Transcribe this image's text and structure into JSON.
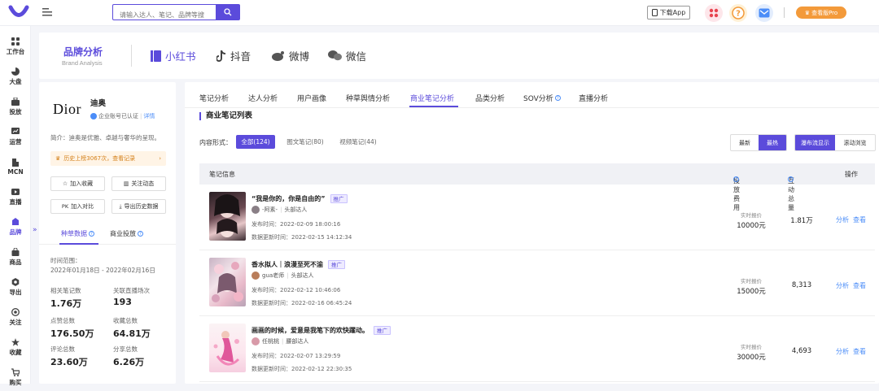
{
  "topbar": {
    "search_placeholder": "请输入达人、笔记、品牌等搜",
    "download_label": "下载App",
    "pro_label": "查看版Pro",
    "accent": "#5b4bdb"
  },
  "sidebar": {
    "items": [
      {
        "label": "工作台",
        "icon": "grid-icon"
      },
      {
        "label": "大盘",
        "icon": "pie-chart-icon"
      },
      {
        "label": "投放",
        "icon": "briefcase-icon"
      },
      {
        "label": "运营",
        "icon": "chart-icon"
      },
      {
        "label": "MCN",
        "icon": "building-icon"
      },
      {
        "label": "直播",
        "icon": "video-icon"
      },
      {
        "label": "品牌",
        "icon": "brand-icon"
      },
      {
        "label": "商品",
        "icon": "bag-icon"
      },
      {
        "label": "导出",
        "icon": "export-icon"
      },
      {
        "label": "关注",
        "icon": "eye-icon"
      },
      {
        "label": "收藏",
        "icon": "star-icon"
      },
      {
        "label": "购买",
        "icon": "cart-icon"
      }
    ],
    "collapse": "»"
  },
  "brand_header": {
    "title": "品牌分析",
    "subtitle": "Brand Analysis",
    "platforms": [
      {
        "label": "小红书"
      },
      {
        "label": "抖音"
      },
      {
        "label": "微博"
      },
      {
        "label": "微信"
      }
    ]
  },
  "brand": {
    "logo_text": "Dior",
    "name": "迪奥",
    "verified": "企业账号已认证",
    "verified_link": "详情",
    "intro": "简介：迪奥是优雅、卓越与奢华的呈现。",
    "history": "历史上榜3067次，查看记录",
    "buttons": {
      "collect": "加入收藏",
      "follow": "关注动态",
      "compare": "加入对比",
      "export_history": "导出历史数据"
    },
    "tabs": [
      "种草数据",
      "商业投放"
    ],
    "range_label": "时间范围：",
    "range_value": "2022年01月18日 - 2022年02月16日",
    "stats": [
      {
        "label": "相关笔记数",
        "value": "1.76万"
      },
      {
        "label": "关联直播场次",
        "value": "193"
      },
      {
        "label": "点赞总数",
        "value": "176.50万"
      },
      {
        "label": "收藏总数",
        "value": "64.81万"
      },
      {
        "label": "评论总数",
        "value": "23.60万"
      },
      {
        "label": "分享总数",
        "value": "6.26万"
      }
    ]
  },
  "main": {
    "tabs": [
      "笔记分析",
      "达人分析",
      "用户画像",
      "种草舆情分析",
      "商业笔记分析",
      "品类分析",
      "SOV分析",
      "直播分析"
    ],
    "section_title": "商业笔记列表",
    "filter_label": "内容形式：",
    "filters": [
      "全部(124)",
      "图文笔记(80)",
      "视频笔记(44)"
    ],
    "sort": [
      "最新",
      "最热"
    ],
    "view": [
      "瀑布流显示",
      "滚动浏览"
    ],
    "columns": {
      "note": "笔记信息",
      "cost": "投放费用",
      "interaction": "互动总量",
      "action": "操作"
    },
    "actions": [
      "分析",
      "查看"
    ],
    "price_label": "实时报价",
    "published_prefix": "发布时间：",
    "updated_prefix": "数据更新时间：",
    "ad_label": "推广",
    "rows": [
      {
        "title": "“我是你的，你是自由的”",
        "author": "-阿素-",
        "tier": "头部达人",
        "published": "2022-02-09 18:00:16",
        "updated": "2022-02-15 14:12:34",
        "price": "10000元",
        "interaction": "1.81万"
      },
      {
        "title": "香水拟人｜浪漫至死不渝",
        "author": "gua老师",
        "tier": "头部达人",
        "published": "2022-02-12 10:46:06",
        "updated": "2022-02-16 06:45:24",
        "price": "15000元",
        "interaction": "8,313"
      },
      {
        "title": "画画的时候，爱意是我笔下的欢快躍动。",
        "author": "任桃桃",
        "tier": "腰部达人",
        "published": "2022-02-07 13:29:59",
        "updated": "2022-02-12 22:30:35",
        "price": "30000元",
        "interaction": "4,693"
      }
    ]
  }
}
